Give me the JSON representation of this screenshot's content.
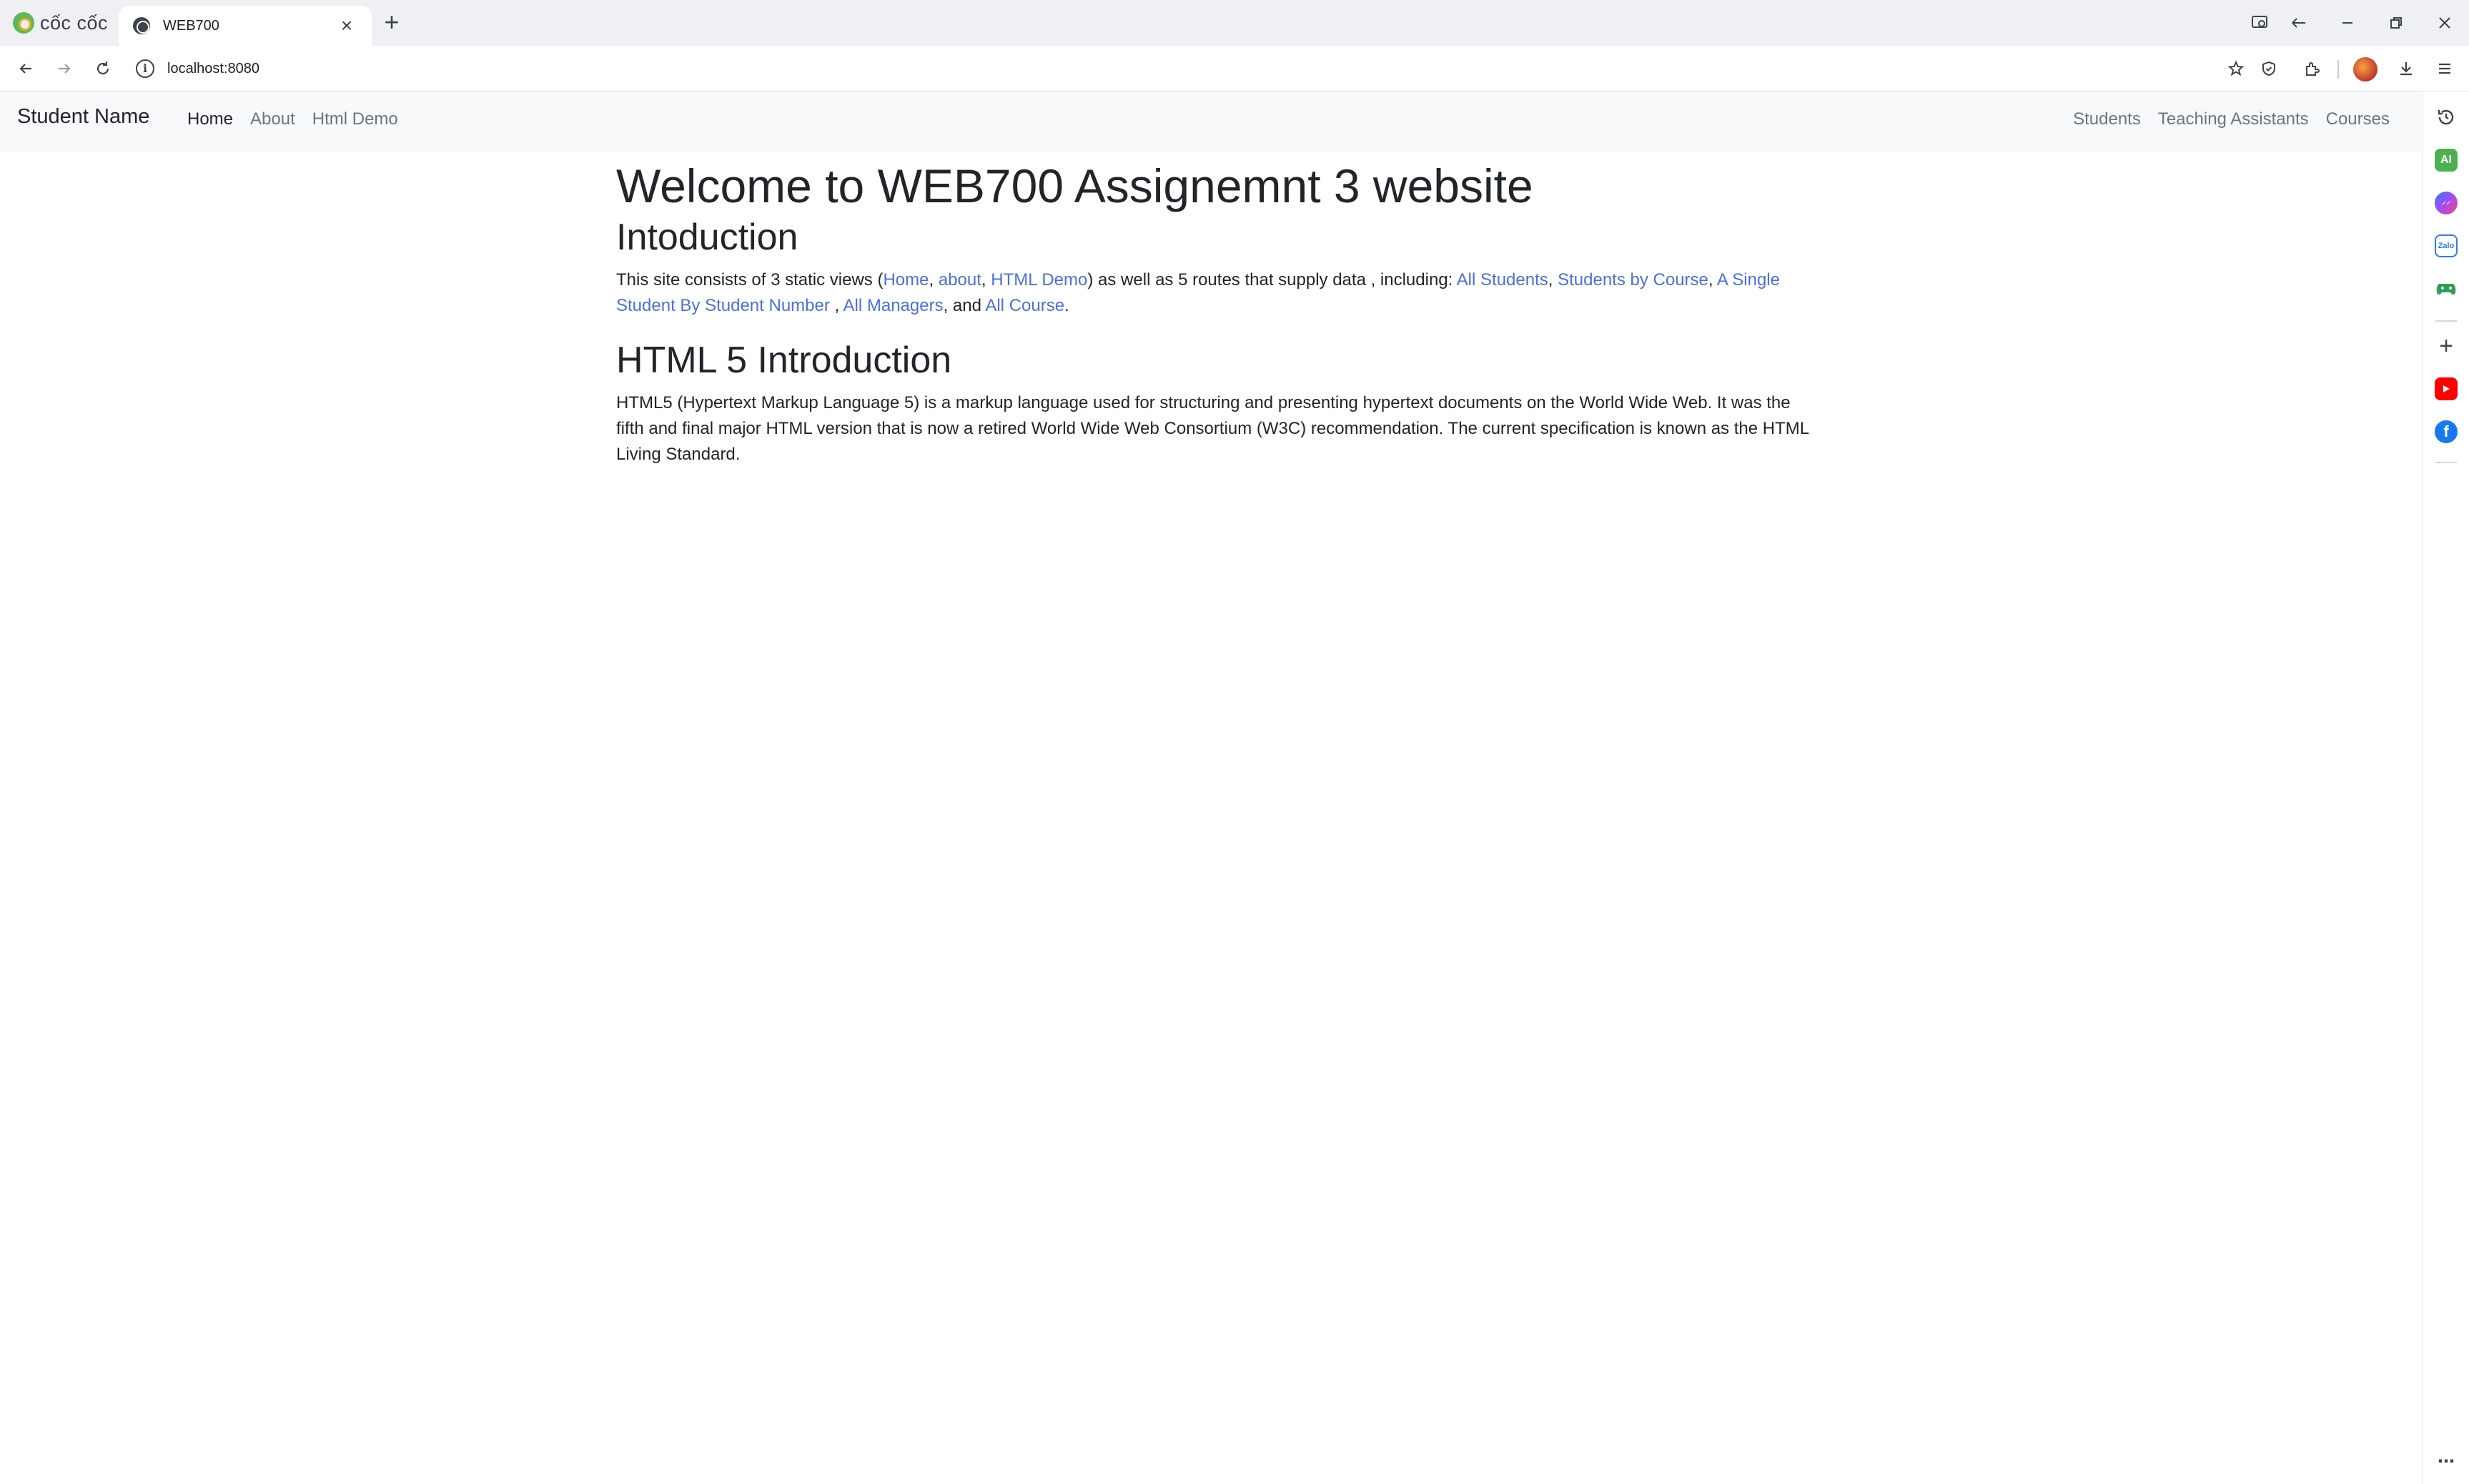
{
  "browser": {
    "brand": "cốc cốc",
    "tab_title": "WEB700",
    "url": "localhost:8080"
  },
  "navbar": {
    "brand": "Student Name",
    "left_links": [
      {
        "label": "Home",
        "active": true
      },
      {
        "label": "About",
        "active": false
      },
      {
        "label": "Html Demo",
        "active": false
      }
    ],
    "right_links": [
      {
        "label": "Students"
      },
      {
        "label": "Teaching Assistants"
      },
      {
        "label": "Courses"
      }
    ]
  },
  "content": {
    "title": "Welcome to WEB700 Assignemnt 3 website",
    "intro_heading": "Intoduction",
    "intro": {
      "prefix": "This site consists of 3 static views (",
      "link_home": "Home",
      "sep1": ", ",
      "link_about": "about",
      "sep2": ", ",
      "link_html_demo": "HTML Demo",
      "middle": ") as well as 5 routes that supply data , including: ",
      "link_all_students": "All Students",
      "sep3": ", ",
      "link_students_by_course": "Students by Course",
      "sep4": ", ",
      "link_single_student": "A Single Student By Student Number",
      "sep5": " , ",
      "link_all_managers": "All Managers",
      "sep6": ", and ",
      "link_all_course": "All Course",
      "suffix": "."
    },
    "html5_heading": "HTML 5 Introduction",
    "html5_text": "HTML5 (Hypertext Markup Language 5) is a markup language used for structuring and presenting hypertext documents on the World Wide Web. It was the fifth and final major HTML version that is now a retired World Wide Web Consortium (W3C) recommendation. The current specification is known as the HTML Living Standard."
  },
  "colors": {
    "link": "#4a6fe2",
    "navbar_bg": "#f8f9fa",
    "chrome_bg": "#eef0f3"
  }
}
